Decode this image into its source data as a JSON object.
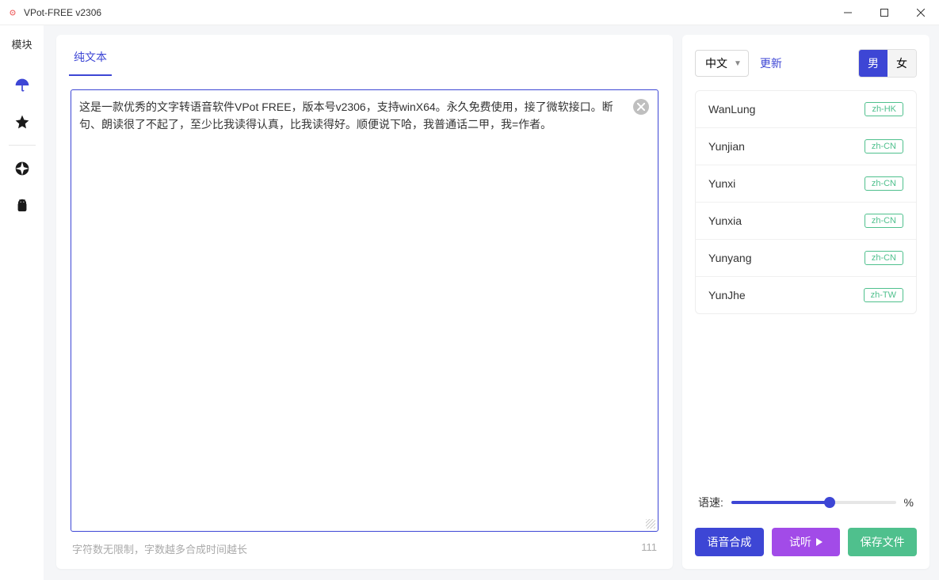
{
  "window": {
    "title": "VPot-FREE v2306"
  },
  "sidebar": {
    "header": "模块"
  },
  "tabs": [
    {
      "label": "纯文本",
      "active": true
    }
  ],
  "editor": {
    "text": "这是一款优秀的文字转语音软件VPot FREE，版本号v2306，支持winX64。永久免费使用，接了微软接口。断句、朗读很了不起了，至少比我读得认真，比我读得好。顺便说下哈，我普通话二甲，我=作者。",
    "hint": "字符数无限制，字数越多合成时间越长",
    "count": "111"
  },
  "right": {
    "language": "中文",
    "update": "更新",
    "gender": {
      "male": "男",
      "female": "女"
    },
    "voices": [
      {
        "name": "WanLung",
        "locale": "zh-HK"
      },
      {
        "name": "Yunjian",
        "locale": "zh-CN"
      },
      {
        "name": "Yunxi",
        "locale": "zh-CN"
      },
      {
        "name": "Yunxia",
        "locale": "zh-CN"
      },
      {
        "name": "Yunyang",
        "locale": "zh-CN"
      },
      {
        "name": "YunJhe",
        "locale": "zh-TW"
      }
    ],
    "speed": {
      "label": "语速:",
      "unit": "%",
      "percent": 60
    },
    "buttons": {
      "synth": "语音合成",
      "preview": "试听",
      "save": "保存文件"
    }
  }
}
